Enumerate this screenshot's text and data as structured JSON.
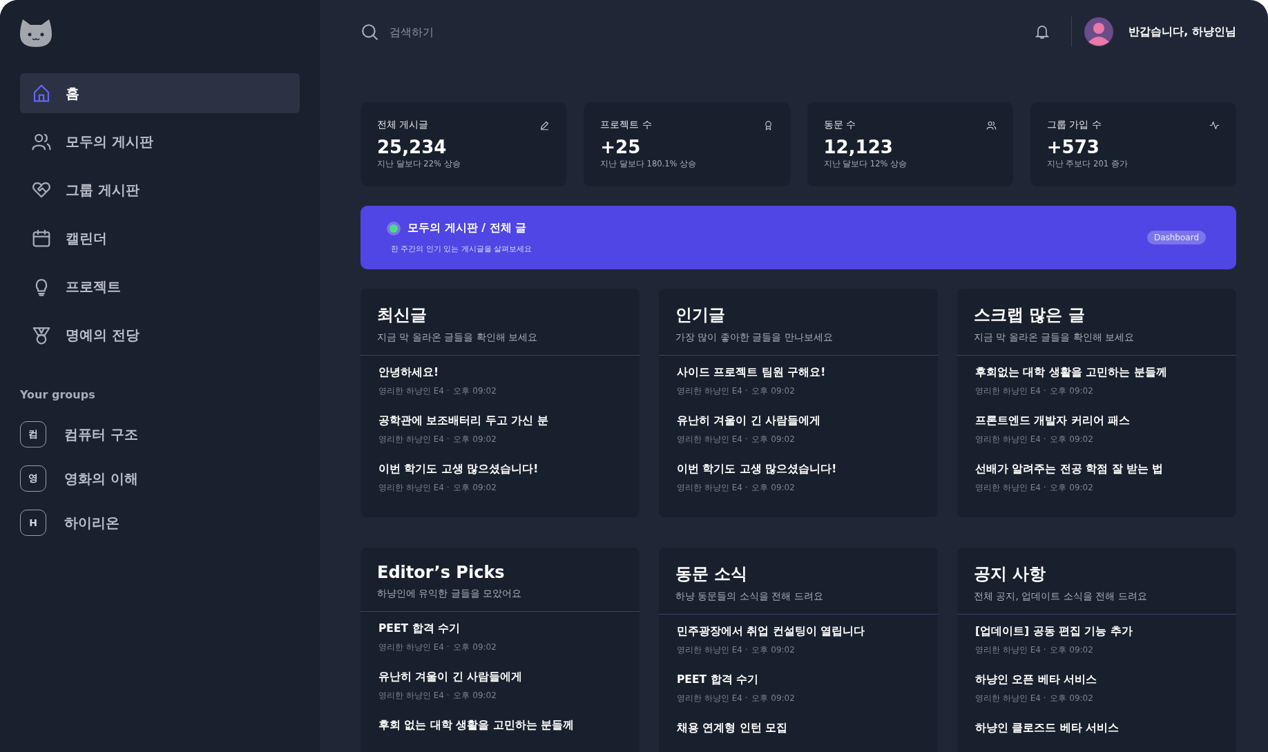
{
  "sidebar": {
    "nav": [
      {
        "label": "홈",
        "selected": true
      },
      {
        "label": "모두의 게시판",
        "selected": false
      },
      {
        "label": "그룹 게시판",
        "selected": false
      },
      {
        "label": "캘린더",
        "selected": false
      },
      {
        "label": "프로젝트",
        "selected": false
      },
      {
        "label": "명예의 전당",
        "selected": false
      }
    ],
    "groups_title": "Your groups",
    "groups": [
      {
        "badge": "컴",
        "label": "컴퓨터 구조"
      },
      {
        "badge": "영",
        "label": "영화의 이해"
      },
      {
        "badge": "H",
        "label": "하이리온"
      }
    ]
  },
  "topbar": {
    "search": {
      "placeholder": "검색하기"
    },
    "greeting": "반갑습니다, 하냥인님"
  },
  "stats": [
    {
      "title": "전체 게시글",
      "value": "25,234",
      "note": "지난 달보다 22% 상승"
    },
    {
      "title": "프로젝트 수",
      "value": "+25",
      "note": "지난 달보다 180.1% 상승"
    },
    {
      "title": "동문 수",
      "value": "12,123",
      "note": "지난 달보다 12% 상승"
    },
    {
      "title": "그룹 가입 수",
      "value": "+573",
      "note": "지난 주보다 201 증가"
    }
  ],
  "banner": {
    "title": "모두의 게시판 / 전체 글",
    "subtitle": "한 주간의 인기 있는 게시글을 살펴보세요",
    "badge": "Dashboard"
  },
  "boards": [
    {
      "title": "최신글",
      "subtitle": "지금 막 올라온 글들을 확인해 보세요",
      "posts": [
        {
          "title": "안녕하세요!",
          "author": "영리한 하냥인 E4 ·",
          "time": "오후 09:02"
        },
        {
          "title": "공학관에 보조배터리 두고 가신 분",
          "author": "영리한 하냥인 E4 ·",
          "time": "오후 09:02"
        },
        {
          "title": "이번 학기도 고생 많으셨습니다!",
          "author": "영리한 하냥인 E4 ·",
          "time": "오후 09:02"
        }
      ]
    },
    {
      "title": "인기글",
      "subtitle": "가장 많이 좋아한 글들을 만나보세요",
      "posts": [
        {
          "title": "사이드 프로젝트 팀원 구해요!",
          "author": "영리한 하냥인 E4 ·",
          "time": "오후 09:02"
        },
        {
          "title": "유난히 겨울이 긴 사람들에게",
          "author": "영리한 하냥인 E4 ·",
          "time": "오후 09:02"
        },
        {
          "title": "이번 학기도 고생 많으셨습니다!",
          "author": "영리한 하냥인 E4 ·",
          "time": "오후 09:02"
        }
      ]
    },
    {
      "title": "스크랩 많은 글",
      "subtitle": "지금 막 올라온 글들을 확인해 보세요",
      "posts": [
        {
          "title": "후회없는 대학 생활을 고민하는 분들께",
          "author": "영리한 하냥인 E4 ·",
          "time": "오후 09:02"
        },
        {
          "title": "프론트엔드 개발자 커리어 패스",
          "author": "영리한 하냥인 E4 ·",
          "time": "오후 09:02"
        },
        {
          "title": "선배가 알려주는 전공 학점 잘 받는 법",
          "author": "영리한 하냥인 E4 ·",
          "time": "오후 09:02"
        }
      ]
    },
    {
      "title": "Editor’s Picks",
      "subtitle": "하냥인에 유익한 글들을 모았어요",
      "posts": [
        {
          "title": "PEET 합격 수기",
          "author": "영리한 하냥인 E4 ·",
          "time": "오후 09:02"
        },
        {
          "title": "유난히 겨울이 긴 사람들에게",
          "author": "영리한 하냥인 E4 ·",
          "time": "오후 09:02"
        },
        {
          "title": "후회 없는 대학 생활을 고민하는 분들께"
        }
      ]
    },
    {
      "title": "동문 소식",
      "subtitle": "하냥 동문들의 소식을 전해 드려요",
      "posts": [
        {
          "title": "민주광장에서 취업 컨설팅이 열립니다",
          "author": "영리한 하냥인 E4 ·",
          "time": "오후 09:02"
        },
        {
          "title": "PEET 합격 수기",
          "author": "영리한 하냥인 E4 ·",
          "time": "오후 09:02"
        },
        {
          "title": "채용 연계형 인턴 모집"
        }
      ]
    },
    {
      "title": "공지 사항",
      "subtitle": "전체 공지, 업데이트 소식을 전해 드려요",
      "posts": [
        {
          "title": "[업데이트] 공동 편집 기능 추가",
          "author": "영리한 하냥인 E4 ·",
          "time": "오후 09:02"
        },
        {
          "title": "하냥인 오픈 베타 서비스",
          "author": "영리한 하냥인 E4 ·",
          "time": "오후 09:02"
        },
        {
          "title": "하냥인 클로즈드 베타 서비스"
        }
      ]
    }
  ]
}
